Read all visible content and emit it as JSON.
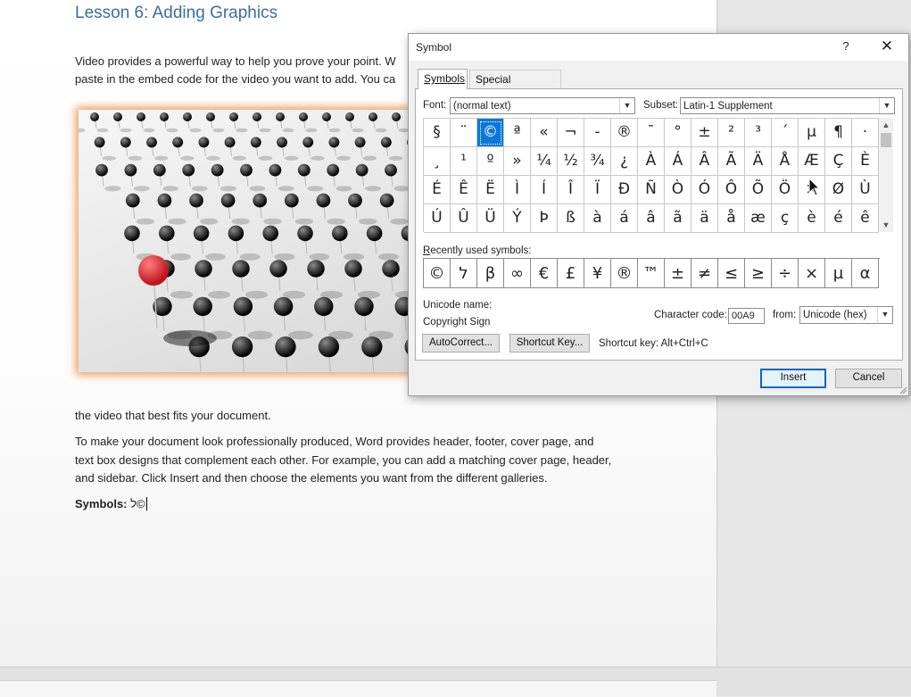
{
  "document": {
    "title": "Lesson 6: Adding Graphics",
    "para1_line1": "Video provides a powerful way to help you prove your point. W",
    "para1_line2": "paste in the embed code for the video you want to add. You ca",
    "para2": "the video that best fits your document.",
    "para3_line1": "To make your document look professionally produced, Word provides header, footer, cover page, and",
    "para3_line2": "text box designs that complement each other. For example, you can add a matching cover page, header,",
    "para3_line3": "and sidebar. Click Insert and then choose the elements you want from the different galleries.",
    "symbols_label": "Symbols:",
    "symbols_value": "ל©"
  },
  "dialog": {
    "title": "Symbol",
    "help": "?",
    "close": "✕",
    "tabs": {
      "symbols": "Symbols",
      "special": "Special Characters"
    },
    "font_label": "Font:",
    "font_value": "(normal text)",
    "subset_label": "Subset:",
    "subset_value": "Latin-1 Supplement",
    "grid": [
      [
        "§",
        "¨",
        "©",
        "ª",
        "«",
        "¬",
        "-",
        "®",
        "¯",
        "°",
        "±",
        "²",
        "³",
        "´",
        "µ",
        "¶",
        "·"
      ],
      [
        "¸",
        "¹",
        "º",
        "»",
        "¼",
        "½",
        "¾",
        "¿",
        "À",
        "Á",
        "Â",
        "Ã",
        "Ä",
        "Å",
        "Æ",
        "Ç",
        "È"
      ],
      [
        "É",
        "Ê",
        "Ë",
        "Ì",
        "Í",
        "Î",
        "Ï",
        "Ð",
        "Ñ",
        "Ò",
        "Ó",
        "Ô",
        "Õ",
        "Ö",
        "×",
        "Ø",
        "Ù"
      ],
      [
        "Ú",
        "Û",
        "Ü",
        "Ý",
        "Þ",
        "ß",
        "à",
        "á",
        "â",
        "ã",
        "ä",
        "å",
        "æ",
        "ç",
        "è",
        "é",
        "ê"
      ]
    ],
    "selected_symbol": "©",
    "recent_label": "Recently used symbols:",
    "recent": [
      "©",
      "ל",
      "β",
      "∞",
      "€",
      "£",
      "¥",
      "®",
      "™",
      "±",
      "≠",
      "≤",
      "≥",
      "÷",
      "×",
      "µ",
      "α"
    ],
    "unicode_name_label": "Unicode name:",
    "unicode_name": "Copyright Sign",
    "char_code_label": "Character code:",
    "char_code": "00A9",
    "from_label": "from:",
    "from_value": "Unicode (hex)",
    "autocorrect_btn": "AutoCorrect...",
    "shortcut_btn": "Shortcut Key...",
    "shortcut_text": "Shortcut key: Alt+Ctrl+C",
    "insert_btn": "Insert",
    "cancel_btn": "Cancel"
  },
  "icons": [
    "help-icon",
    "close-icon",
    "chevron-down-icon",
    "scroll-up-icon",
    "scroll-down-icon",
    "resize-grip-icon",
    "mouse-pointer-icon"
  ],
  "colors": {
    "heading": "#3a6f9f",
    "selection": "#0a78d7",
    "picture_glow": "#e88c3c",
    "pin_red": "#c0141a"
  }
}
